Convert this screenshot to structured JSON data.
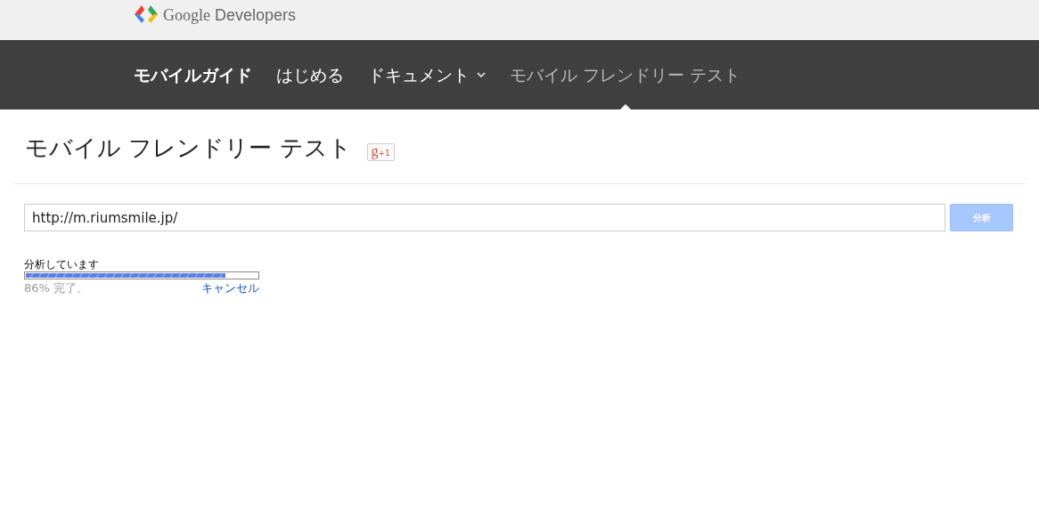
{
  "header": {
    "logo_words": [
      "Google",
      "Developers"
    ]
  },
  "nav": {
    "items": [
      {
        "label": "モバイルガイド",
        "kind": "title",
        "selected": false
      },
      {
        "label": "はじめる",
        "kind": "link",
        "selected": false
      },
      {
        "label": "ドキュメント",
        "kind": "dropdown",
        "selected": false
      },
      {
        "label": "モバイル フレンドリー テスト",
        "kind": "link",
        "selected": true
      }
    ]
  },
  "page": {
    "title": "モバイル フレンドリー テスト",
    "plus_one": {
      "g": "g",
      "count": "+1"
    }
  },
  "form": {
    "url": "http://m.riumsmile.jp/",
    "button": {
      "label": "分析",
      "disabled": true
    }
  },
  "progress": {
    "label": "分析しています",
    "level": 0.86,
    "status": "86% 完了。",
    "cancel": "キャンセル"
  }
}
